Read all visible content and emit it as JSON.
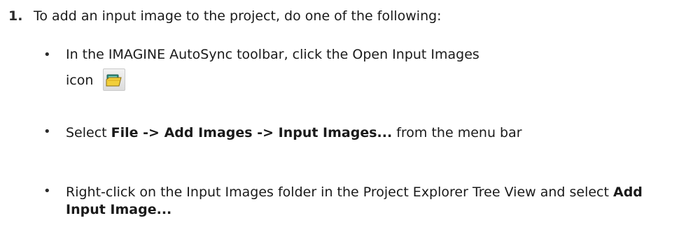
{
  "step": {
    "number": "1.",
    "text": "To add an input image to the project, do one of the following:"
  },
  "bullets": [
    {
      "marker": "•",
      "line1": "In the IMAGINE AutoSync toolbar, click the Open Input Images",
      "line2": "icon",
      "icon_name": "open-input-images-icon"
    },
    {
      "marker": "•",
      "prefix": "Select ",
      "bold": "File -> Add Images -> Input Images...",
      "suffix": " from the menu bar"
    },
    {
      "marker": "•",
      "prefix": "Right-click on the Input Images folder in the Project Explorer Tree View and select ",
      "bold": "Add Input Image..."
    }
  ]
}
